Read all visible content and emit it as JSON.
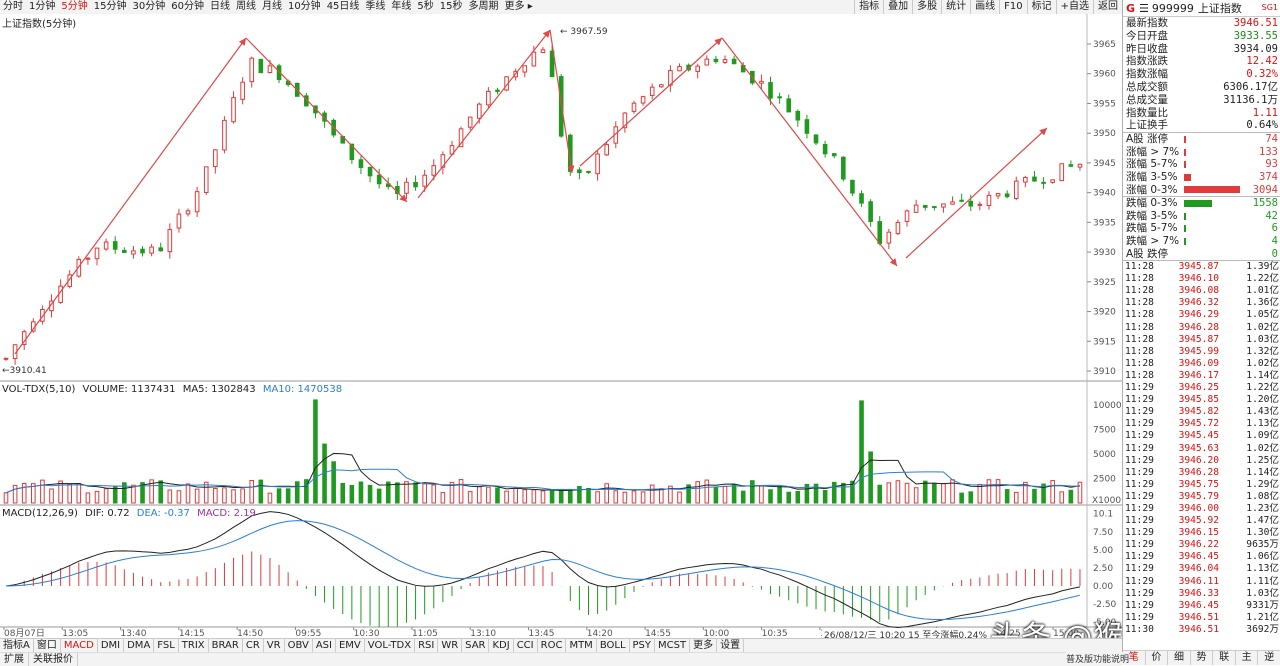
{
  "toolbar": {
    "periods": [
      "分时",
      "1分钟",
      "5分钟",
      "15分钟",
      "30分钟",
      "60分钟",
      "日线",
      "周线",
      "月线",
      "10分钟",
      "45日线",
      "季线",
      "年线",
      "5秒",
      "15秒",
      "多周期",
      "更多 ▸"
    ],
    "active_period": "5分钟",
    "tools": [
      "指标",
      "叠加",
      "多股",
      "统计",
      "画线",
      "F10",
      "标记",
      "+自选",
      "返回"
    ]
  },
  "chart": {
    "title": "上证指数(5分钟)",
    "high_label": "3967.59",
    "low_label": "3910.41",
    "y_ticks": [
      "3965",
      "3960",
      "3955",
      "3950",
      "3945",
      "3940",
      "3935",
      "3930",
      "3925",
      "3920",
      "3915",
      "3910"
    ],
    "time_labels": [
      "08月07日",
      "13:05",
      "13:40",
      "14:15",
      "14:50",
      "09:55",
      "10:30",
      "11:05",
      "13:10",
      "13:45",
      "14:20",
      "14:55",
      "10:00",
      "10:35",
      "11:10",
      "13:15",
      "13:50",
      "14:25",
      "15:00"
    ],
    "status_text": "26/08/12/三 10:20 15 至今涨幅0.24%"
  },
  "volume": {
    "title": "VOL-TDX(5,10)",
    "volume_label": "VOLUME: 1137431",
    "ma5_label": "MA5: 1302843",
    "ma10_label": "MA10: 1470538",
    "y_ticks": [
      "10000",
      "7500",
      "5000",
      "2500"
    ],
    "unit": "X1000"
  },
  "macd": {
    "title": "MACD(12,26,9)",
    "dif_label": "DIF: 0.72",
    "dea_label": "DEA: -0.37",
    "macd_label": "MACD: 2.19",
    "y_ticks": [
      "10.1",
      "7.50",
      "5.00",
      "2.50",
      "0.00",
      "-2.50",
      "-5.00",
      "-7.50"
    ]
  },
  "colors": {
    "up": "#e03a3a",
    "down": "#1f9a1f",
    "arrow": "#e04848",
    "ma_black": "#222222",
    "ma_blue": "#2a7fd4"
  },
  "panel": {
    "star": "G",
    "code": "999999",
    "name": "上证指数",
    "badge": "SG1",
    "stats": [
      {
        "label": "最新指数",
        "value": "3946.51",
        "color": "red"
      },
      {
        "label": "今日开盘",
        "value": "3933.55",
        "color": "green"
      },
      {
        "label": "昨日收盘",
        "value": "3934.09",
        "color": "black"
      },
      {
        "label": "指数涨跌",
        "value": "12.42",
        "color": "red"
      },
      {
        "label": "指数涨幅",
        "value": "0.32%",
        "color": "red"
      },
      {
        "label": "总成交额",
        "value": "6306.17亿",
        "color": "black"
      },
      {
        "label": "总成交量",
        "value": "31136.1万",
        "color": "black"
      },
      {
        "label": "指数量比",
        "value": "1.11",
        "color": "red"
      },
      {
        "label": "上证换手",
        "value": "0.64%",
        "color": "black"
      }
    ],
    "dist_up": [
      {
        "label": "A股 涨停",
        "count": "74",
        "fraction": 0.02
      },
      {
        "label": "涨幅 > 7%",
        "count": "133",
        "fraction": 0.04
      },
      {
        "label": "涨幅 5-7%",
        "count": "93",
        "fraction": 0.03
      },
      {
        "label": "涨幅 3-5%",
        "count": "374",
        "fraction": 0.12
      },
      {
        "label": "涨幅 0-3%",
        "count": "3094",
        "fraction": 1.0
      }
    ],
    "dist_down": [
      {
        "label": "跌幅 0-3%",
        "count": "1558",
        "fraction": 0.5
      },
      {
        "label": "跌幅 3-5%",
        "count": "42",
        "fraction": 0.015
      },
      {
        "label": "跌幅 5-7%",
        "count": "6",
        "fraction": 0.005
      },
      {
        "label": "跌幅 > 7%",
        "count": "4",
        "fraction": 0.005
      },
      {
        "label": "A股 跌停",
        "count": "0",
        "fraction": 0
      }
    ],
    "ticks": [
      [
        "11:28",
        "3945.87",
        "1.39亿"
      ],
      [
        "11:28",
        "3946.10",
        "1.22亿"
      ],
      [
        "11:28",
        "3946.08",
        "1.01亿"
      ],
      [
        "11:28",
        "3946.32",
        "1.36亿"
      ],
      [
        "11:28",
        "3946.29",
        "1.05亿"
      ],
      [
        "11:28",
        "3946.28",
        "1.02亿"
      ],
      [
        "11:28",
        "3945.87",
        "1.03亿"
      ],
      [
        "11:28",
        "3945.99",
        "1.32亿"
      ],
      [
        "11:28",
        "3946.09",
        "1.02亿"
      ],
      [
        "11:28",
        "3946.17",
        "1.14亿"
      ],
      [
        "11:29",
        "3946.25",
        "1.22亿"
      ],
      [
        "11:29",
        "3945.85",
        "1.20亿"
      ],
      [
        "11:29",
        "3945.82",
        "1.43亿"
      ],
      [
        "11:29",
        "3945.72",
        "1.13亿"
      ],
      [
        "11:29",
        "3945.45",
        "1.09亿"
      ],
      [
        "11:29",
        "3945.63",
        "1.02亿"
      ],
      [
        "11:29",
        "3946.20",
        "1.25亿"
      ],
      [
        "11:29",
        "3946.28",
        "1.14亿"
      ],
      [
        "11:29",
        "3945.75",
        "1.29亿"
      ],
      [
        "11:29",
        "3945.79",
        "1.08亿"
      ],
      [
        "11:29",
        "3946.00",
        "1.23亿"
      ],
      [
        "11:29",
        "3945.92",
        "1.47亿"
      ],
      [
        "11:29",
        "3946.15",
        "1.30亿"
      ],
      [
        "11:29",
        "3946.22",
        "9635万"
      ],
      [
        "11:29",
        "3946.45",
        "1.06亿"
      ],
      [
        "11:29",
        "3946.04",
        "1.13亿"
      ],
      [
        "11:29",
        "3946.11",
        "1.11亿"
      ],
      [
        "11:29",
        "3946.33",
        "1.03亿"
      ],
      [
        "11:29",
        "3946.45",
        "9331万"
      ],
      [
        "11:29",
        "3946.51",
        "1.21亿"
      ],
      [
        "11:30",
        "3946.51",
        "3692万"
      ]
    ],
    "bottom_tabs": [
      "笔",
      "价",
      "细",
      "势",
      "联",
      "主",
      "逆"
    ],
    "bottom_label": "普及版功能说明"
  },
  "bottom": {
    "index_tabs": [
      "指标A",
      "窗口",
      "MACD",
      "DMI",
      "DMA",
      "FSL",
      "TRIX",
      "BRAR",
      "CR",
      "VR",
      "OBV",
      "ASI",
      "EMV",
      "VOL-TDX",
      "RSI",
      "WR",
      "SAR",
      "KDJ",
      "CCI",
      "ROC",
      "MTM",
      "BOLL",
      "PSY",
      "MCST",
      "更多",
      "设置"
    ],
    "active_tab": "MACD",
    "row2": [
      "扩展",
      "关联报价"
    ]
  },
  "watermark": "头条 @猴哥聊缠论"
}
